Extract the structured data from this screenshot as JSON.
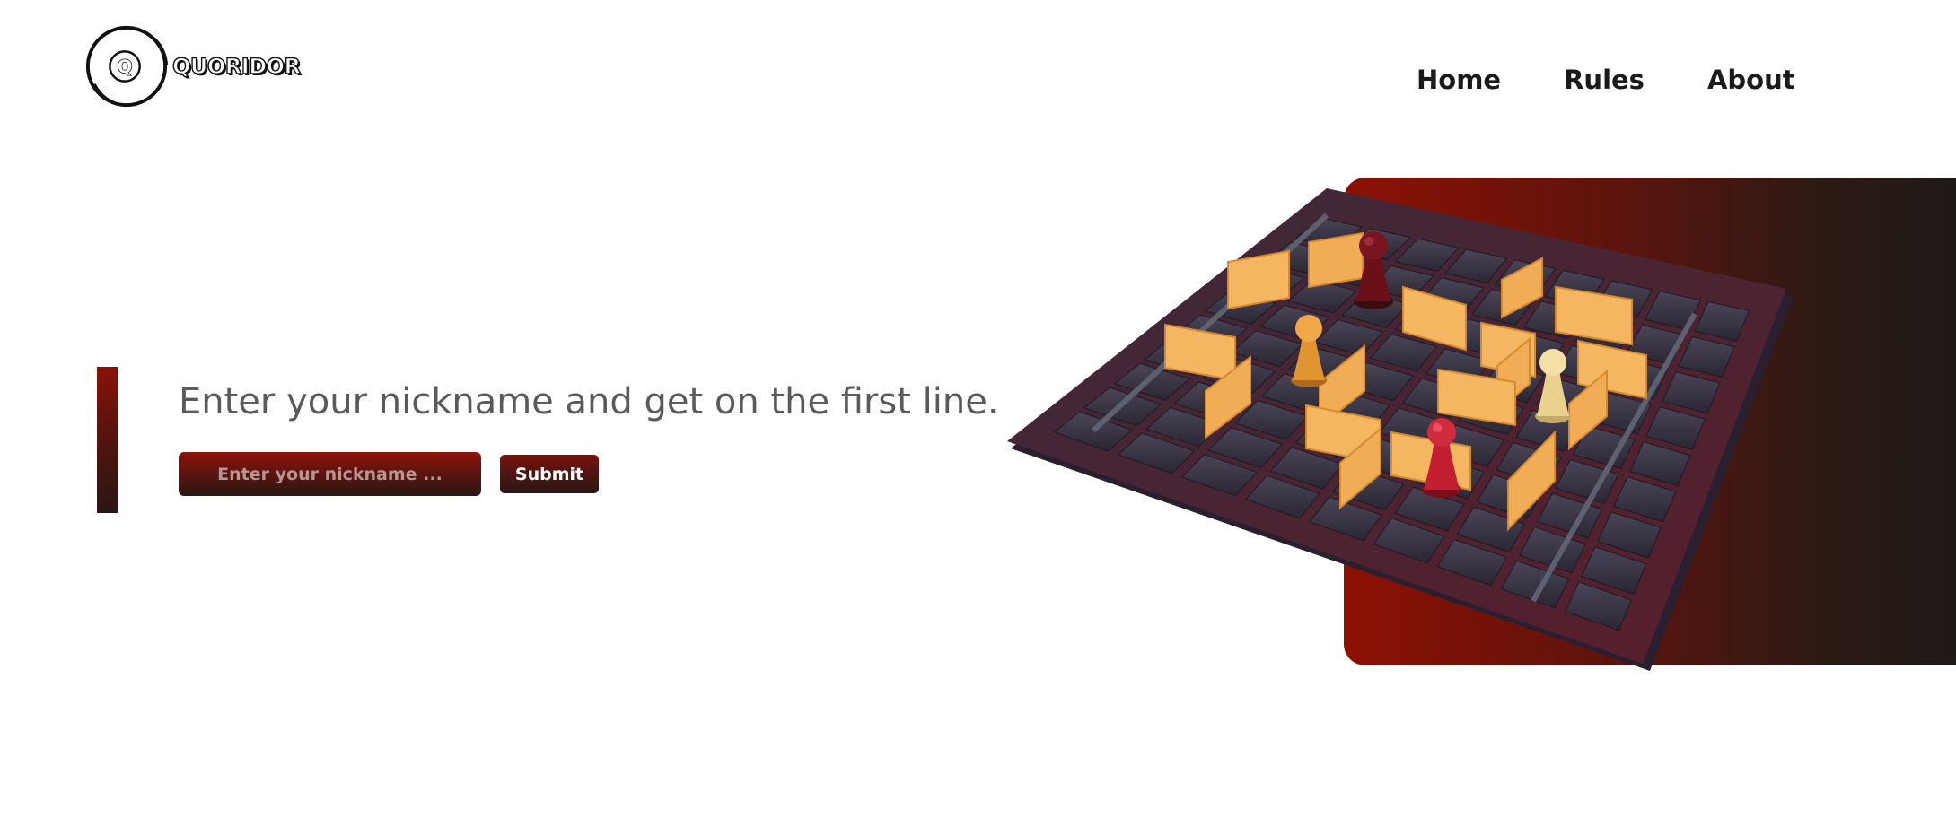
{
  "header": {
    "logo": {
      "letter": "Q",
      "wordmark": "QUORIDOR"
    },
    "nav": [
      {
        "label": "Home"
      },
      {
        "label": "Rules"
      },
      {
        "label": "About"
      }
    ]
  },
  "hero": {
    "tagline": "Enter your nickname and get on the first line.",
    "nickname_input": {
      "value": "",
      "placeholder": "Enter your nickname ..."
    },
    "submit_label": "Submit",
    "image_icon": "quoridor-board-icon"
  },
  "colors": {
    "accent_dark_red": "#8d1104",
    "accent_dark": "#1f1a17",
    "wall_wood": "#f4b35a",
    "board_tile": "#3a3442",
    "nav_text": "#1a1a1a",
    "tagline_text": "#5a5a5a"
  }
}
